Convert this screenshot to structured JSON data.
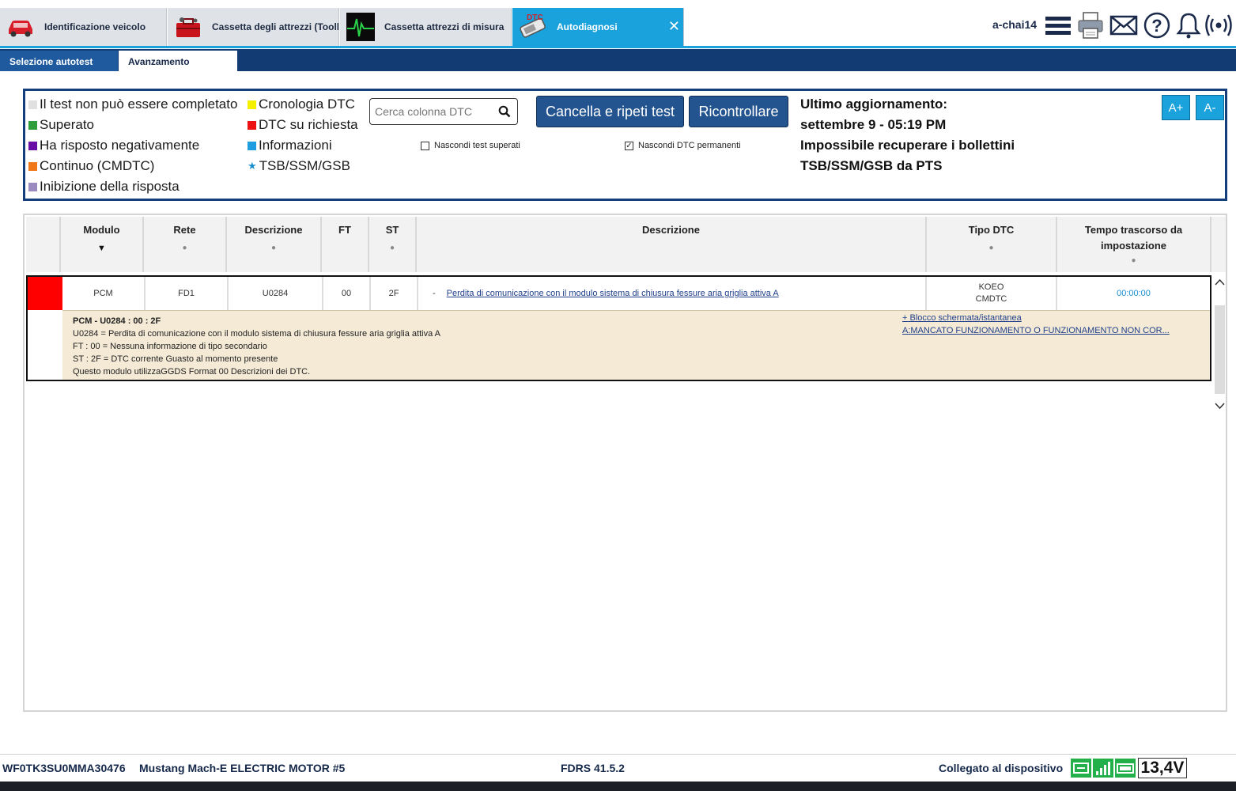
{
  "tabs": [
    {
      "label": "Identificazione veicolo",
      "icon": "car-icon"
    },
    {
      "label": "Cassetta degli attrezzi (Toolbox)",
      "icon": "toolbox-icon"
    },
    {
      "label": "Cassetta attrezzi di misura",
      "icon": "oscilloscope-icon"
    },
    {
      "label": "Autodiagnosi",
      "icon": "dtc-scanner-icon",
      "icon_text": "DTC",
      "active": true
    }
  ],
  "header": {
    "username": "a-chai14"
  },
  "subtabs": [
    "Selezione autotest",
    "Avanzamento"
  ],
  "legend": {
    "col1": [
      {
        "label": "Il test non può essere completato",
        "color": "#e0e0e0"
      },
      {
        "label": "Superato",
        "color": "#2e9e3c"
      },
      {
        "label": "Ha risposto negativamente",
        "color": "#6a0fa6"
      },
      {
        "label": "Continuo (CMDTC)",
        "color": "#f07818"
      },
      {
        "label": "Inibizione della risposta",
        "color": "#9a8ac0"
      }
    ],
    "col2": [
      {
        "label": "Cronologia DTC",
        "color": "#f5f000"
      },
      {
        "label": "DTC su richiesta",
        "color": "#ee1111"
      },
      {
        "label": "Informazioni",
        "color": "#1e9ee0"
      },
      {
        "label": "TSB/SSM/GSB",
        "icon": "star-icon"
      }
    ]
  },
  "search": {
    "placeholder": "Cerca colonna DTC"
  },
  "buttons": {
    "clear_retest": "Cancella e ripeti test",
    "recheck": "Ricontrollare",
    "font_up": "A+",
    "font_down": "A-"
  },
  "checkboxes": [
    {
      "label": "Nascondi test superati",
      "checked": false
    },
    {
      "label": "Nascondi DTC permanenti",
      "checked": true
    }
  ],
  "update": {
    "line1": "Ultimo aggiornamento:",
    "line2": "settembre 9 - 05:19 PM",
    "line3": "Impossibile recuperare i bollettini",
    "line4": "TSB/SSM/GSB da PTS"
  },
  "table": {
    "columns": [
      "Modulo",
      "Rete",
      "Descrizione",
      "FT",
      "ST",
      "Descrizione",
      "Tipo DTC",
      "Tempo trascorso da impostazione"
    ],
    "rows": [
      {
        "modulo": "PCM",
        "rete": "FD1",
        "codice": "U0284",
        "ft": "00",
        "st": "2F",
        "dash": "-",
        "descrizione": "Perdita di comunicazione con il modulo sistema di chiusura fessure aria griglia attiva A",
        "tipo1": "KOEO",
        "tipo2": "CMDTC",
        "tempo": "00:00:00",
        "detail": {
          "title": "PCM - U0284 : 00 : 2F",
          "lines": [
            "U0284 = Perdita di comunicazione con il modulo sistema di chiusura fessure aria griglia attiva A",
            "FT : 00 = Nessuna informazione di tipo secondario",
            "ST : 2F = DTC corrente Guasto al momento presente",
            "Questo modulo utilizzaGGDS Format 00 Descrizioni dei DTC."
          ],
          "link1": "+ Blocco schermata/istantanea",
          "link2": "A:MANCATO FUNZIONAMENTO O FUNZIONAMENTO NON COR..."
        }
      }
    ]
  },
  "status": {
    "vin": "WF0TK3SU0MMA30476",
    "vehicle": "Mustang Mach-E ELECTRIC MOTOR #5",
    "version": "FDRS 41.5.2",
    "connection": "Collegato al dispositivo",
    "voltage": "13,4V"
  }
}
